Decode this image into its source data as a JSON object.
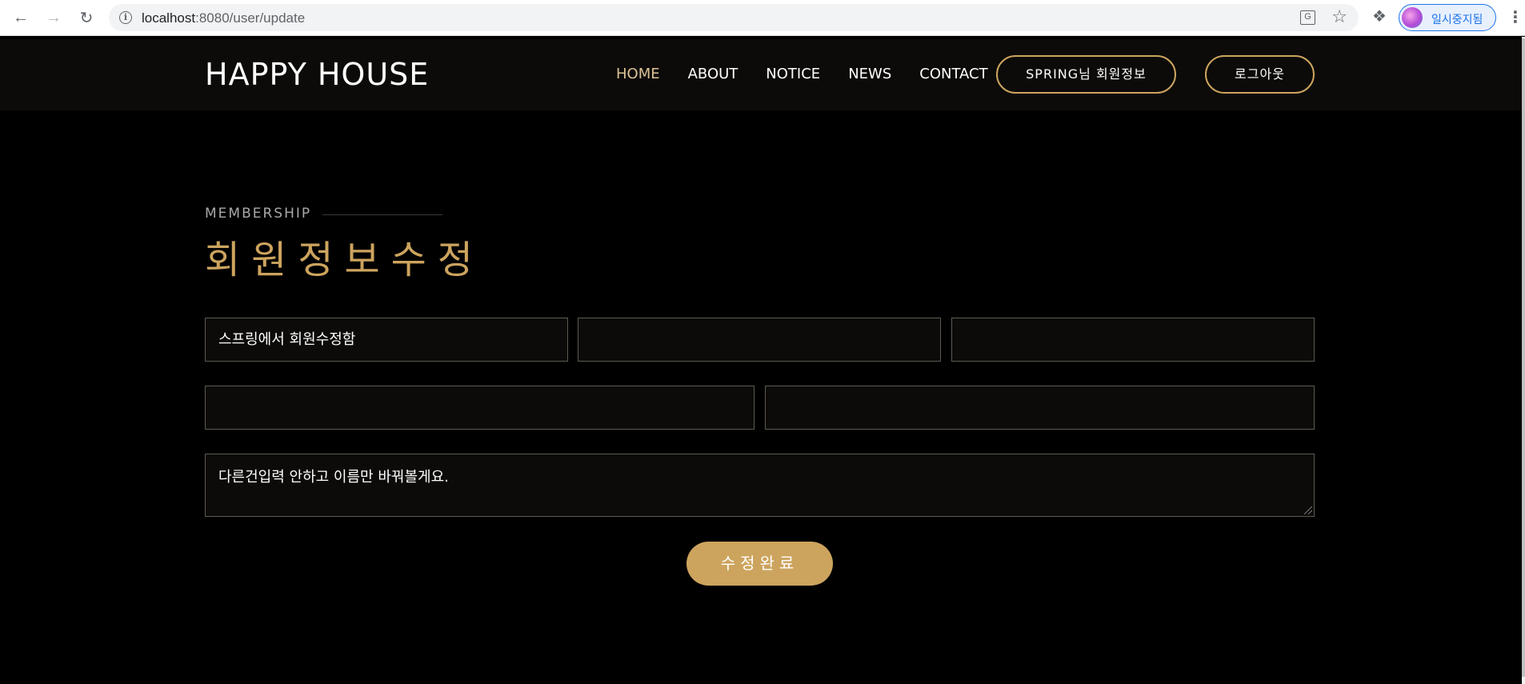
{
  "browser": {
    "url_host": "localhost",
    "url_rest": ":8080/user/update",
    "profile_label": "일시중지됨"
  },
  "header": {
    "logo": "HAPPY HOUSE",
    "nav": [
      "HOME",
      "ABOUT",
      "NOTICE",
      "NEWS",
      "CONTACT"
    ],
    "active_nav": "HOME",
    "profile_button": "SPRING님 회원정보",
    "logout_button": "로그아웃"
  },
  "section": {
    "subtitle": "MEMBERSHIP",
    "title": "회원정보수정"
  },
  "form": {
    "name_value": "스프링에서 회원수정함",
    "field2_value": "",
    "field3_value": "",
    "field4_value": "",
    "field5_value": "",
    "message_value": "다른건입력 안하고 이름만 바꿔볼게요.",
    "submit_label": "수정완료"
  },
  "colors": {
    "accent": "#cda45e",
    "active_nav": "#dcc296",
    "background": "#000000",
    "header_bg": "#0c0b09"
  },
  "icons": [
    "back-icon",
    "forward-icon",
    "reload-icon",
    "info-icon",
    "translate-icon",
    "star-icon",
    "extensions-icon",
    "avatar",
    "menu-icon"
  ]
}
